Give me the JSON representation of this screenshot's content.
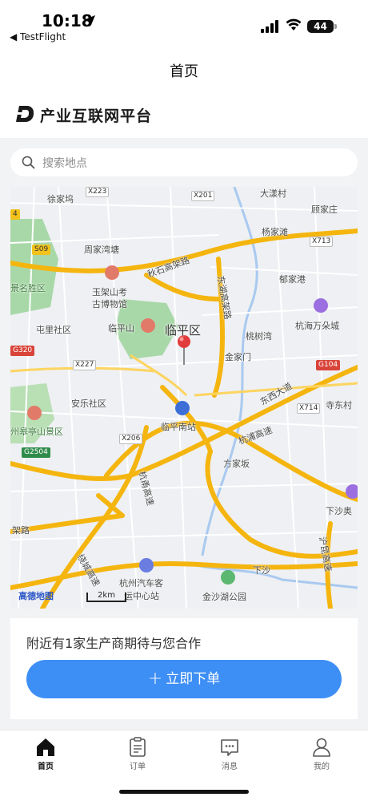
{
  "status": {
    "time": "10:18",
    "back_app": "◀ TestFlight",
    "battery": "44"
  },
  "page_title": "首页",
  "brand": {
    "name": "产业互联网平台"
  },
  "search": {
    "placeholder": "搜索地点"
  },
  "map": {
    "district": "临平区",
    "credit": "高德地图",
    "scale": "2km",
    "labels": [
      "徐家坞",
      "周家湾塘",
      "大漾村",
      "顾家庄",
      "杨家滩",
      "郁家港",
      "玉架山考",
      "古博物馆",
      "景名胜区",
      "屯里社区",
      "临平山",
      "桃树湾",
      "金家门",
      "杭海万朵城",
      "安乐社区",
      "临平南站",
      "寺东村",
      "方家坂",
      "州皋亭山景区",
      "下沙奥",
      "下沙",
      "杭州汽车客",
      "运中心站",
      "金沙湖公园",
      "秋石高架路",
      "东湖高架路",
      "东西大道",
      "杭浦高速",
      "杭甬高速",
      "绕城高速",
      "沪昆高速",
      "架路"
    ],
    "road_tags": [
      "X223",
      "X201",
      "S09",
      "X713",
      "G320",
      "X227",
      "G104",
      "X714",
      "X206",
      "G2504",
      "4"
    ]
  },
  "promo": {
    "text": "附近有1家生产商期待与您合作"
  },
  "order_button": {
    "plus": "+",
    "label": "立即下单"
  },
  "tabs": [
    {
      "label": "首页",
      "icon": "home-icon",
      "active": true
    },
    {
      "label": "订单",
      "icon": "clipboard-icon",
      "active": false
    },
    {
      "label": "消息",
      "icon": "message-icon",
      "active": false
    },
    {
      "label": "我的",
      "icon": "user-icon",
      "active": false
    }
  ],
  "colors": {
    "accent": "#3d8ef5",
    "map_highway": "#f5b50f",
    "map_park": "#a8d8a8"
  }
}
